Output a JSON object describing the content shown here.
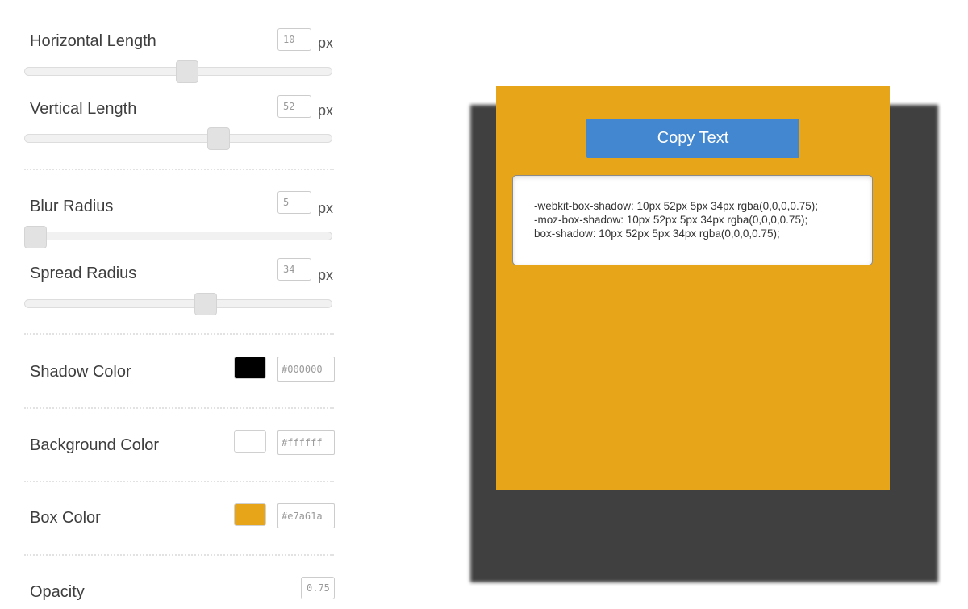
{
  "controls": {
    "horizontal": {
      "label": "Horizontal Length",
      "value": "10",
      "unit": "px"
    },
    "vertical": {
      "label": "Vertical Length",
      "value": "52",
      "unit": "px"
    },
    "blur": {
      "label": "Blur Radius",
      "value": "5",
      "unit": "px"
    },
    "spread": {
      "label": "Spread Radius",
      "value": "34",
      "unit": "px"
    },
    "shadow_color": {
      "label": "Shadow Color",
      "value": "#000000",
      "swatch": "#000000"
    },
    "background_color": {
      "label": "Background Color",
      "value": "#ffffff",
      "swatch": "#ffffff"
    },
    "box_color": {
      "label": "Box Color",
      "value": "#e7a61a",
      "swatch": "#e7a61a"
    },
    "opacity": {
      "label": "Opacity",
      "value": "0.75"
    }
  },
  "preview": {
    "box_color": "#e7a61a",
    "shadow_color": "#404040",
    "copy_button": {
      "label": "Copy Text",
      "color": "#4387d0"
    },
    "code_lines": [
      "-webkit-box-shadow: 10px 52px 5px 34px rgba(0,0,0,0.75);",
      "-moz-box-shadow: 10px 52px 5px 34px rgba(0,0,0,0.75);",
      "box-shadow: 10px 52px 5px 34px rgba(0,0,0,0.75);"
    ]
  }
}
